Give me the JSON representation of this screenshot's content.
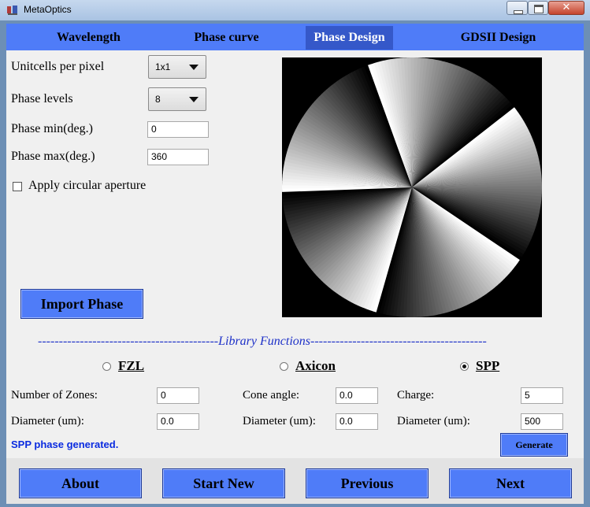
{
  "window": {
    "title": "MetaOptics"
  },
  "tabs": [
    {
      "label": "Wavelength"
    },
    {
      "label": "Phase curve"
    },
    {
      "label": "Phase Design"
    },
    {
      "label": "GDSII Design"
    }
  ],
  "settings": {
    "unitcells_label": "Unitcells per pixel",
    "unitcells_value": "1x1",
    "phase_levels_label": "Phase levels",
    "phase_levels_value": "8",
    "phase_min_label": "Phase min(deg.)",
    "phase_min_value": "0",
    "phase_max_label": "Phase max(deg.)",
    "phase_max_value": "360",
    "aperture_label": "Apply circular aperture",
    "aperture_checked": false
  },
  "import_button": "Import Phase",
  "library": {
    "title": "-------------------------------------------Library Functions------------------------------------------",
    "options": [
      {
        "label": "FZL",
        "selected": false
      },
      {
        "label": "Axicon",
        "selected": false
      },
      {
        "label": "SPP",
        "selected": true
      }
    ],
    "fzl": {
      "zones_label": "Number of Zones:",
      "zones_value": "0",
      "diameter_label": "Diameter (um):",
      "diameter_value": "0.0"
    },
    "axicon": {
      "cone_label": "Cone angle:",
      "cone_value": "0.0",
      "diameter_label": "Diameter (um):",
      "diameter_value": "0.0"
    },
    "spp": {
      "charge_label": "Charge:",
      "charge_value": "5",
      "diameter_label": "Diameter (um):",
      "diameter_value": "500"
    },
    "generate_button": "Generate"
  },
  "status": "SPP phase generated.",
  "nav": {
    "about": "About",
    "start_new": "Start New",
    "previous": "Previous",
    "next": "Next"
  },
  "phase_pattern": {
    "spiral_charge": 5
  },
  "colors": {
    "accent": "#4f7cf8",
    "active_tab": "#3558c9",
    "status": "#0a2be0",
    "library_title": "#1e31c8"
  }
}
